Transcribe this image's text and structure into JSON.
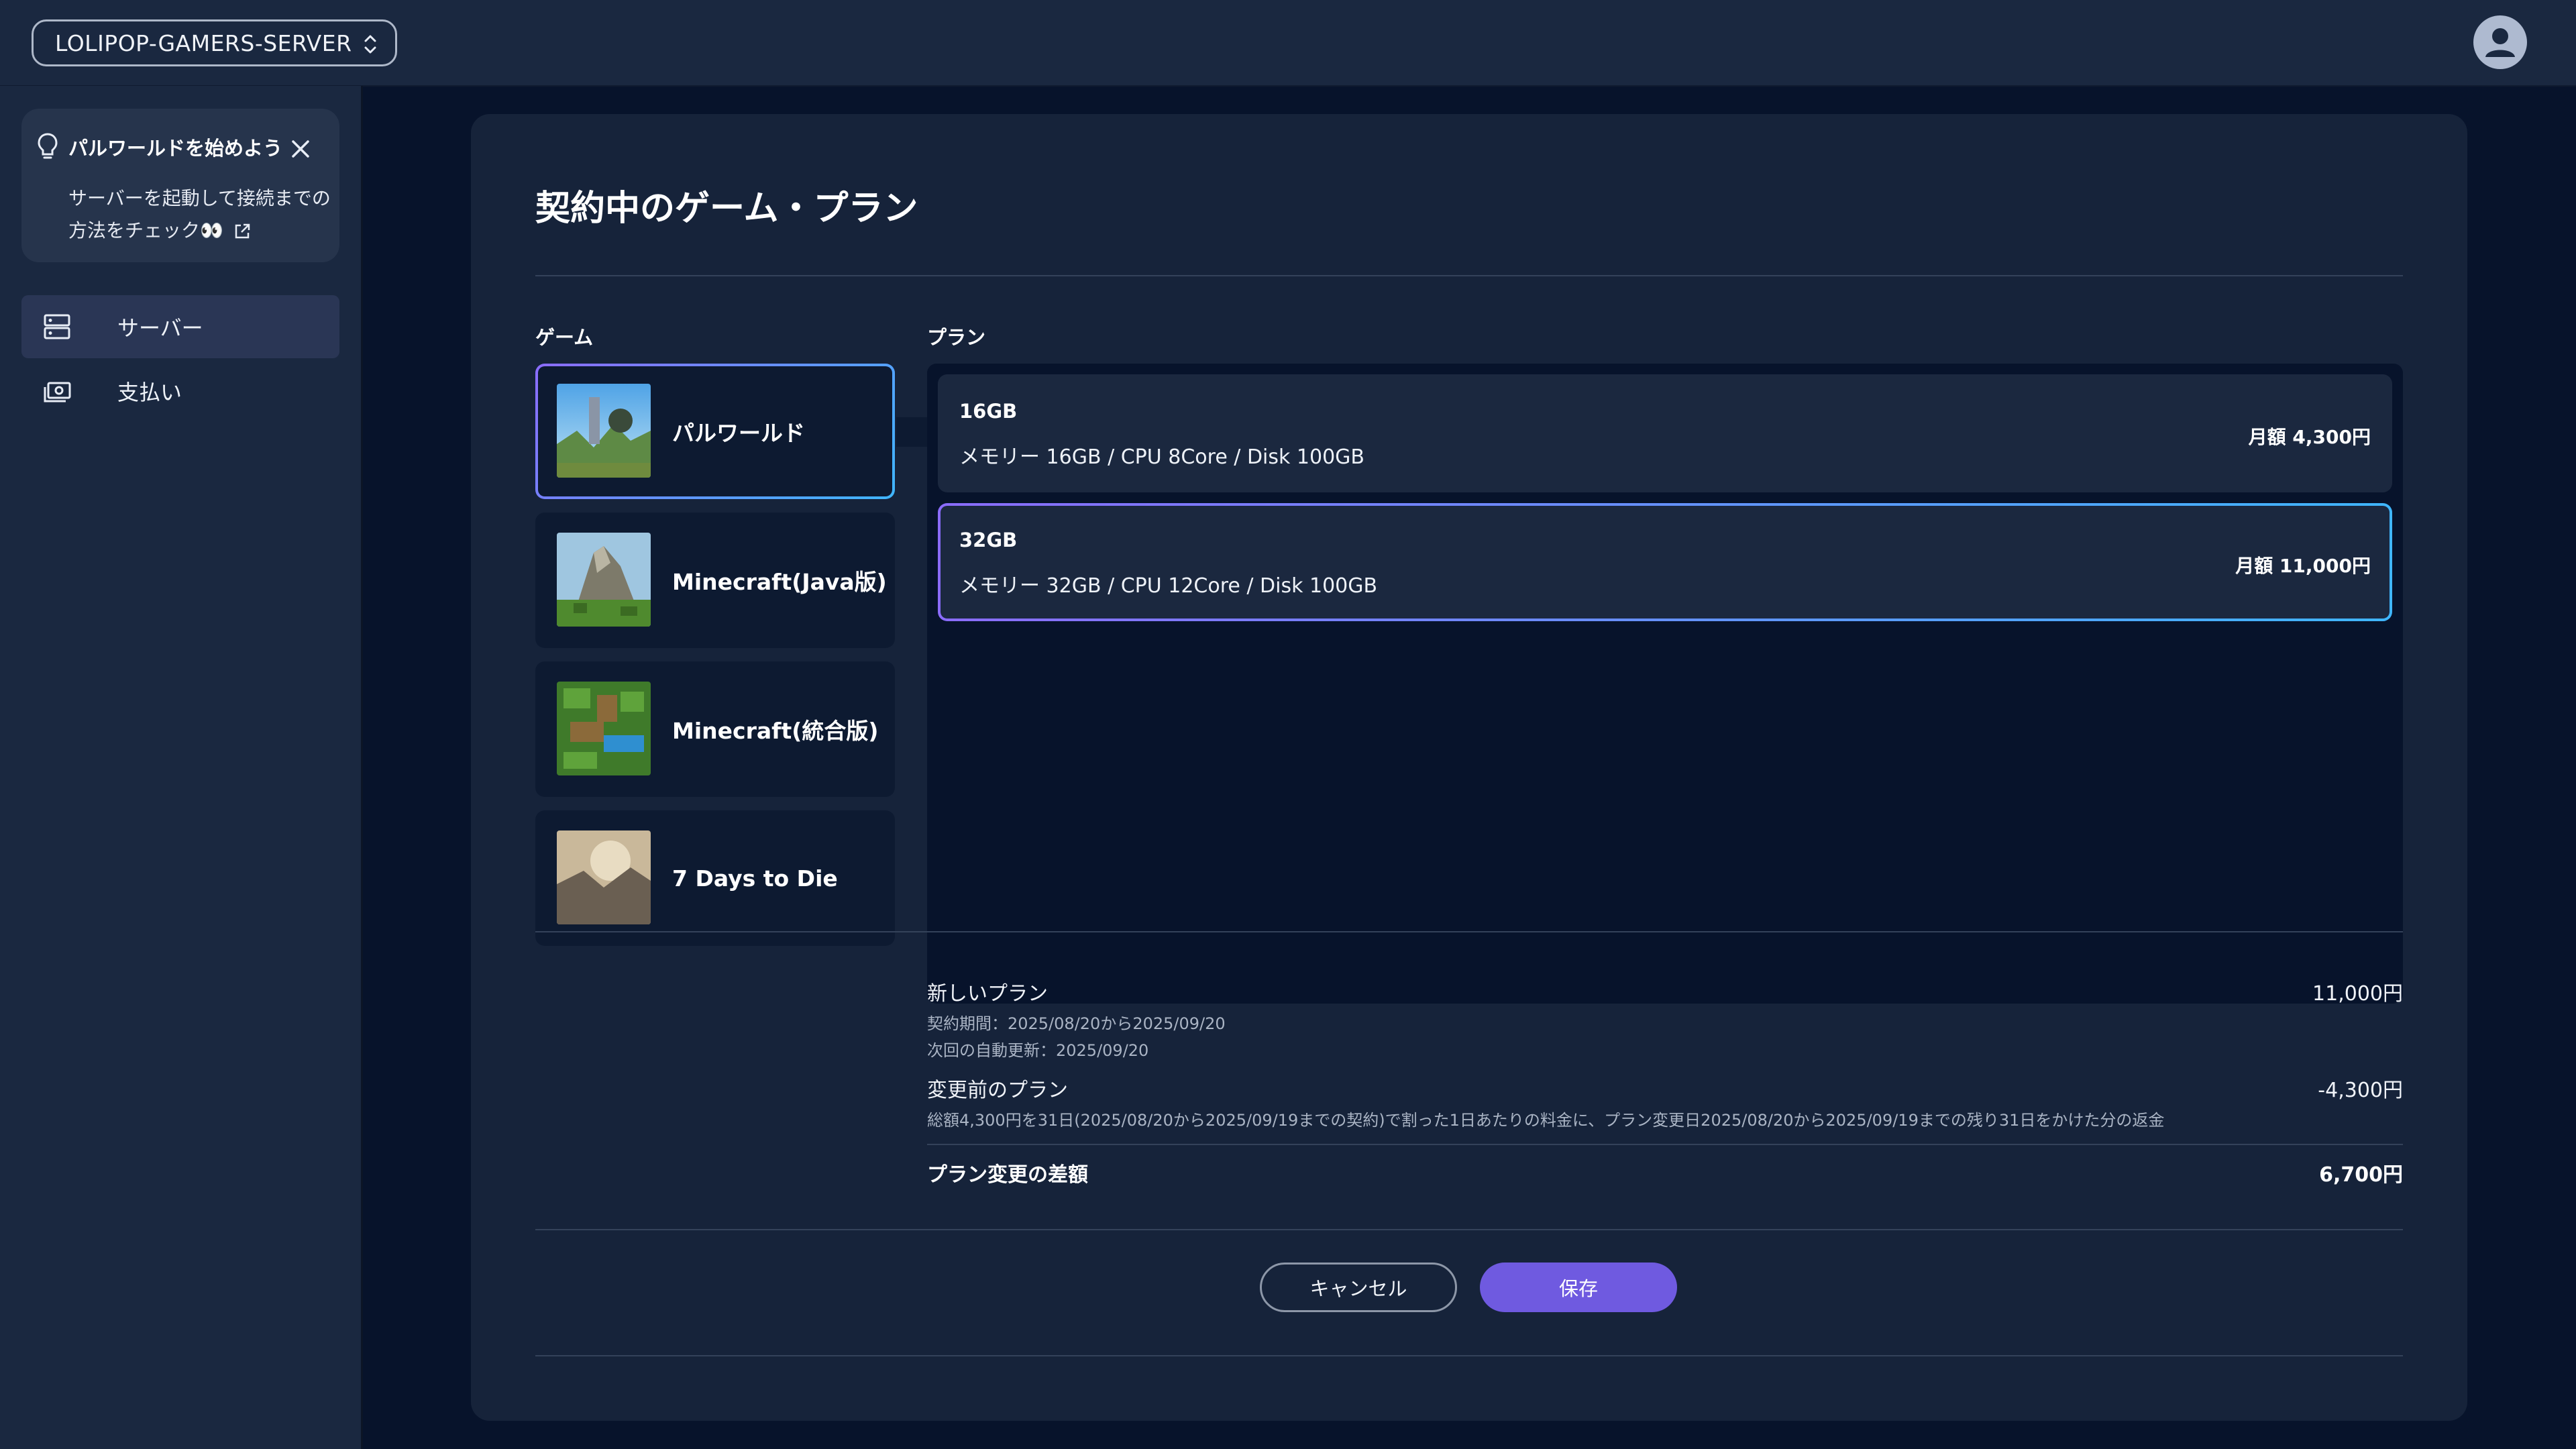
{
  "topbar": {
    "server_name": "LOLIPOP-GAMERS-SERVER",
    "avatar_icon": "user-avatar-icon"
  },
  "sidebar": {
    "tip": {
      "title": "パルワールドを始めよう",
      "body": "サーバーを起動して接続までの方法をチェック👀"
    },
    "items": [
      {
        "label": "サーバー",
        "icon": "server-icon",
        "active": true
      },
      {
        "label": "支払い",
        "icon": "payment-icon",
        "active": false
      }
    ]
  },
  "main": {
    "title": "契約中のゲーム・プラン",
    "games_heading": "ゲーム",
    "plans_heading": "プラン",
    "games": [
      {
        "name": "パルワールド",
        "selected": true
      },
      {
        "name": "Minecraft(Java版)",
        "selected": false
      },
      {
        "name": "Minecraft(統合版)",
        "selected": false
      },
      {
        "name": "7 Days to Die",
        "selected": false
      }
    ],
    "plans": [
      {
        "name": "16GB",
        "spec": "メモリー 16GB / CPU 8Core / Disk 100GB",
        "price": "月額  4,300円",
        "selected": false
      },
      {
        "name": "32GB",
        "spec": "メモリー 32GB / CPU 12Core / Disk 100GB",
        "price": "月額  11,000円",
        "selected": true
      }
    ]
  },
  "summary": {
    "new_plan_label": "新しいプラン",
    "new_plan_value": "11,000円",
    "contract_period": "契約期間：2025/08/20から2025/09/20",
    "next_renewal": "次回の自動更新：2025/09/20",
    "old_plan_label": "変更前のプラン",
    "old_plan_value": "-4,300円",
    "old_plan_note": "総額4,300円を31日(2025/08/20から2025/09/19までの契約)で割った1日あたりの料金に、プラン変更日2025/08/20から2025/09/19までの残り31日をかけた分の返金",
    "diff_label": "プラン変更の差額",
    "diff_value": "6,700円"
  },
  "actions": {
    "cancel_label": "キャンセル",
    "save_label": "保存"
  },
  "colors": {
    "accent": "#6f5ae0",
    "selection_gradient_start": "#8b6cff",
    "selection_gradient_end": "#3fb6ff",
    "background": "#07132b"
  }
}
